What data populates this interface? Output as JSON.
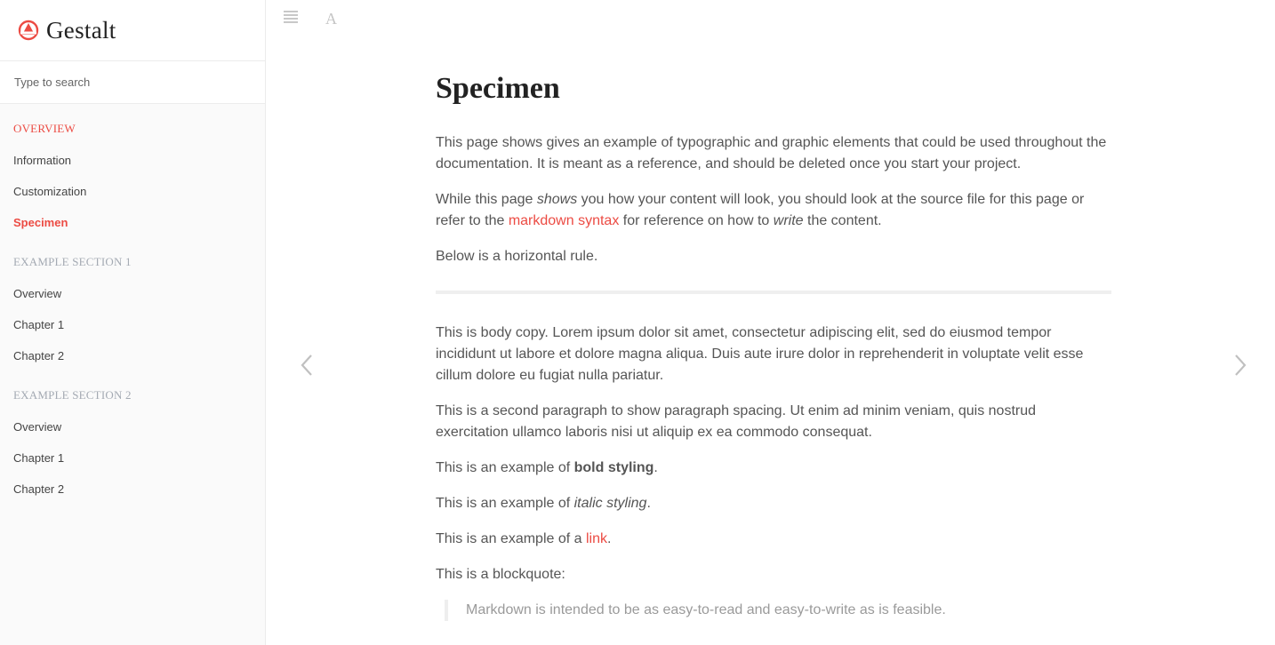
{
  "brand": {
    "name": "Gestalt",
    "accent": "#ec4b43"
  },
  "search": {
    "placeholder": "Type to search"
  },
  "sidebar": {
    "sections": [
      {
        "title": "OVERVIEW",
        "items": [
          "Information",
          "Customization",
          "Specimen"
        ]
      },
      {
        "title": "EXAMPLE SECTION 1",
        "items": [
          "Overview",
          "Chapter 1",
          "Chapter 2"
        ]
      },
      {
        "title": "EXAMPLE SECTION 2",
        "items": [
          "Overview",
          "Chapter 1",
          "Chapter 2"
        ]
      }
    ],
    "current_item": "Specimen"
  },
  "toolbar": {
    "menu_icon": "hamburger-menu-icon",
    "font_icon": "A"
  },
  "pagination": {
    "prev_icon": "chevron-left-icon",
    "next_icon": "chevron-right-icon"
  },
  "content": {
    "title": "Specimen",
    "intro": "This page shows gives an example of typographic and graphic elements that could be used throughout the documentation. It is meant as a reference, and should be deleted once you start your project.",
    "p2_a": "While this page ",
    "p2_em1": "shows",
    "p2_b": " you how your content will look, you should look at the source file for this page or refer to the ",
    "p2_link": "markdown syntax",
    "p2_c": " for reference on how to ",
    "p2_em2": "write",
    "p2_d": " the content.",
    "hr_intro": "Below is a horizontal rule.",
    "body1": "This is body copy. Lorem ipsum dolor sit amet, consectetur adipiscing elit, sed do eiusmod tempor incididunt ut labore et dolore magna aliqua. Duis aute irure dolor in reprehenderit in voluptate velit esse cillum dolore eu fugiat nulla pariatur.",
    "body2": "This is a second paragraph to show paragraph spacing. Ut enim ad minim veniam, quis nostrud exercitation ullamco laboris nisi ut aliquip ex ea commodo consequat.",
    "bold_pre": "This is an example of ",
    "bold_text": "bold styling",
    "bold_post": ".",
    "italic_pre": "This is an example of ",
    "italic_text": "italic styling",
    "italic_post": ".",
    "link_pre": "This is an example of a ",
    "link_text": "link",
    "link_post": ".",
    "bq_intro": "This is a blockquote:",
    "blockquote": "Markdown is intended to be as easy-to-read and easy-to-write as is feasible."
  }
}
